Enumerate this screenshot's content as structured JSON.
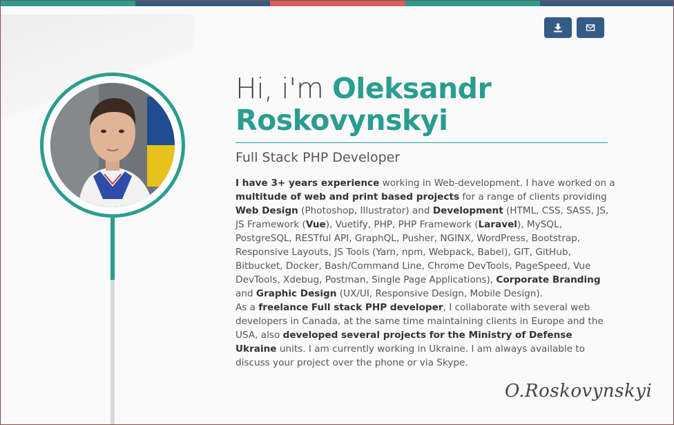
{
  "topbar": {
    "colors": [
      "#2a9d8f",
      "#345c85",
      "#d9615b",
      "#2a9d8f",
      "#345c85"
    ]
  },
  "actions": [
    {
      "name": "download-button",
      "icon": "download-icon"
    },
    {
      "name": "email-button",
      "icon": "envelope-icon"
    }
  ],
  "profile": {
    "greeting": "Hi, i'm",
    "first_name": "Oleksandr",
    "last_name": "Roskovynskyi",
    "title": "Full Stack PHP Developer",
    "accent_color": "#2a9d8f"
  },
  "bio": {
    "p1": [
      {
        "t": "I have 3+ years experience",
        "b": true
      },
      {
        "t": " working in Web-development. I have worked on a ",
        "b": false
      },
      {
        "t": "multitude of web and print based projects",
        "b": true
      },
      {
        "t": " for a range of clients providing ",
        "b": false
      },
      {
        "t": "Web Design",
        "b": true
      },
      {
        "t": " (Photoshop, Illustrator) and ",
        "b": false
      },
      {
        "t": "Development",
        "b": true
      },
      {
        "t": " (HTML, CSS, SASS, JS, JS Framework (",
        "b": false
      },
      {
        "t": "Vue",
        "b": true
      },
      {
        "t": "), Vuetify, PHP, PHP Framework (",
        "b": false
      },
      {
        "t": "Laravel",
        "b": true
      },
      {
        "t": "), MySQL, PostgreSQL, RESTful API, GraphQL, Pusher, NGINX, WordPress, Bootstrap, Responsive Layouts, JS Tools (Yarn, npm, Webpack, Babel), GIT, GitHub, Bitbucket, Docker, Bash/Command Line, Chrome DevTools, PageSpeed, Vue DevTools, Xdebug, Postman, Single Page Applications), ",
        "b": false
      },
      {
        "t": "Corporate Branding",
        "b": true
      },
      {
        "t": " and ",
        "b": false
      },
      {
        "t": "Graphic Design",
        "b": true
      },
      {
        "t": " (UX/UI, Responsive Design, Mobile Design).",
        "b": false
      }
    ],
    "p2": [
      {
        "t": "As a ",
        "b": false
      },
      {
        "t": "freelance Full stack PHP developer",
        "b": true
      },
      {
        "t": ", I collaborate with several web developers in Canada, at the same time maintaining clients in Europe and the USA, also ",
        "b": false
      },
      {
        "t": "developed several projects for the Ministry of Defense Ukraine",
        "b": true
      },
      {
        "t": " units. I am currently working in Ukraine. I am always available to discuss your project over the phone or via Skype.",
        "b": false
      }
    ]
  },
  "signature": "O.Roskovynskyi"
}
